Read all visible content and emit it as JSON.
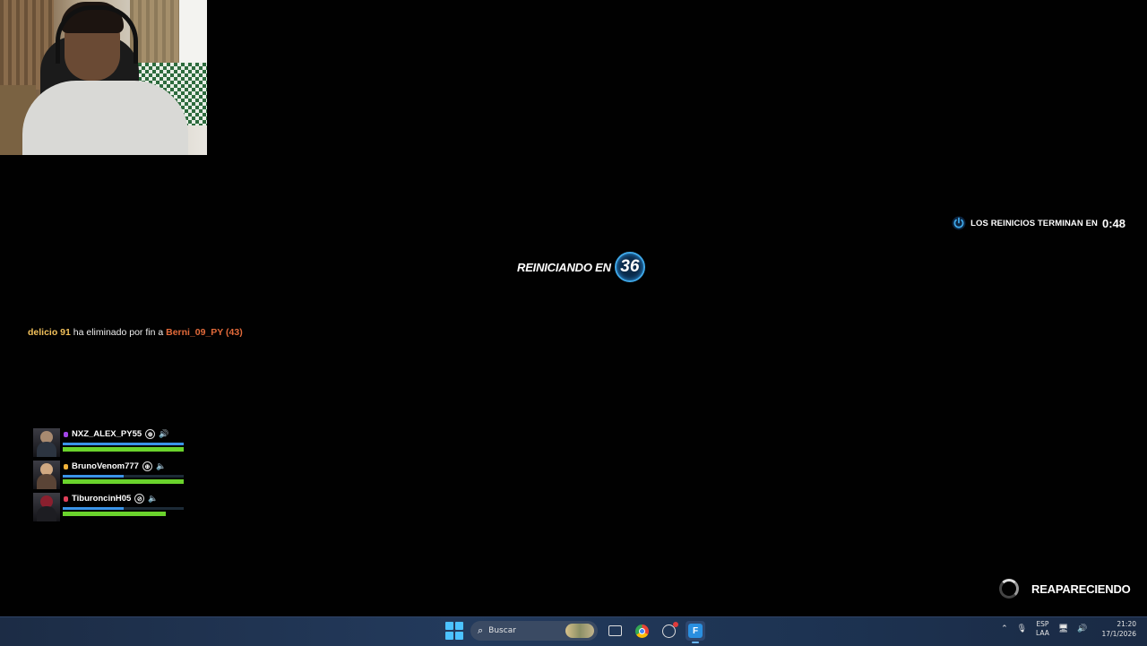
{
  "respawn_end": {
    "label": "LOS REINICIOS TERMINAN EN",
    "time": "0:48",
    "icon": "power-icon"
  },
  "restarting": {
    "label": "REINICIANDO EN",
    "countdown": "36"
  },
  "killfeed": {
    "killer": "delicio 91",
    "message": "ha eliminado por fin a",
    "victim": "Berni_09_PY (43)"
  },
  "squad": [
    {
      "name": "NXZ_ALEX_PY55",
      "rank_color": "#a245e8",
      "shield": 1.0,
      "health": 1.0,
      "mic": "full"
    },
    {
      "name": "BrunoVenom777",
      "rank_color": "#f2b33a",
      "shield": 0.5,
      "health": 1.0,
      "mic": "low"
    },
    {
      "name": "TiburoncinH05",
      "rank_color": "#e0405a",
      "shield": 0.5,
      "health": 0.85,
      "mic": "muted"
    }
  ],
  "reappear": {
    "label": "REAPARECIENDO"
  },
  "taskbar": {
    "search_label": "Buscar",
    "lang_top": "ESP",
    "lang_bottom": "LAA",
    "time": "21:20",
    "date": "17/1/2026"
  },
  "colors": {
    "accent_blue": "#2d8fd8",
    "health": "#6ad32c",
    "shield": "#3a93e8",
    "killer": "#f2c15b",
    "victim": "#e26a3a"
  }
}
